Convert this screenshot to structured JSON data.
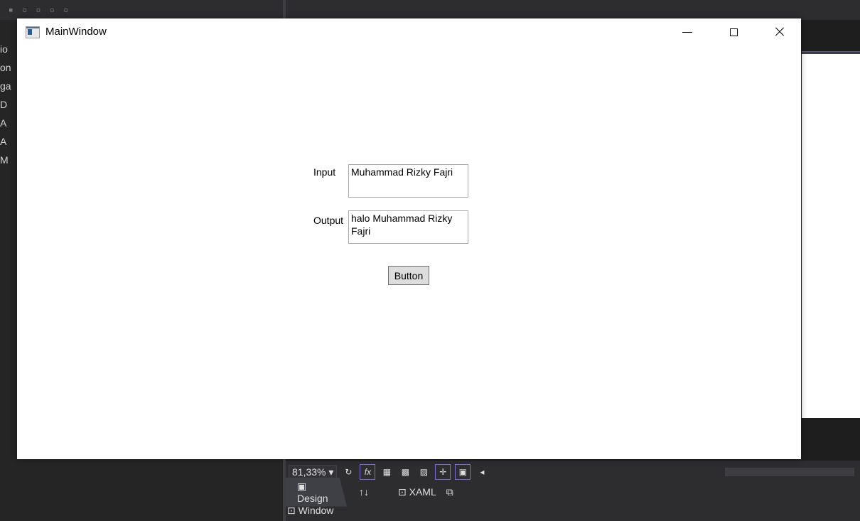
{
  "window": {
    "title": "MainWindow"
  },
  "form": {
    "input_label": "Input",
    "input_value": "Muhammad Rizky Fajri",
    "output_label": "Output",
    "output_value": "halo Muhammad Rizky Fajri",
    "button_label": "Button"
  },
  "ide": {
    "left_letters": [
      "io",
      "on",
      "ga",
      "D",
      "A",
      "A",
      "M"
    ],
    "zoom": "81,33%",
    "tabs": {
      "design": "Design",
      "swap": "↑↓",
      "xaml": "XAML"
    },
    "breadcrumb": "Window"
  },
  "colors": {
    "ide_background": "#1e1e1e",
    "window_background": "#ffffff",
    "button_face": "#dddddd",
    "accent_border": "#7f6bd6"
  }
}
